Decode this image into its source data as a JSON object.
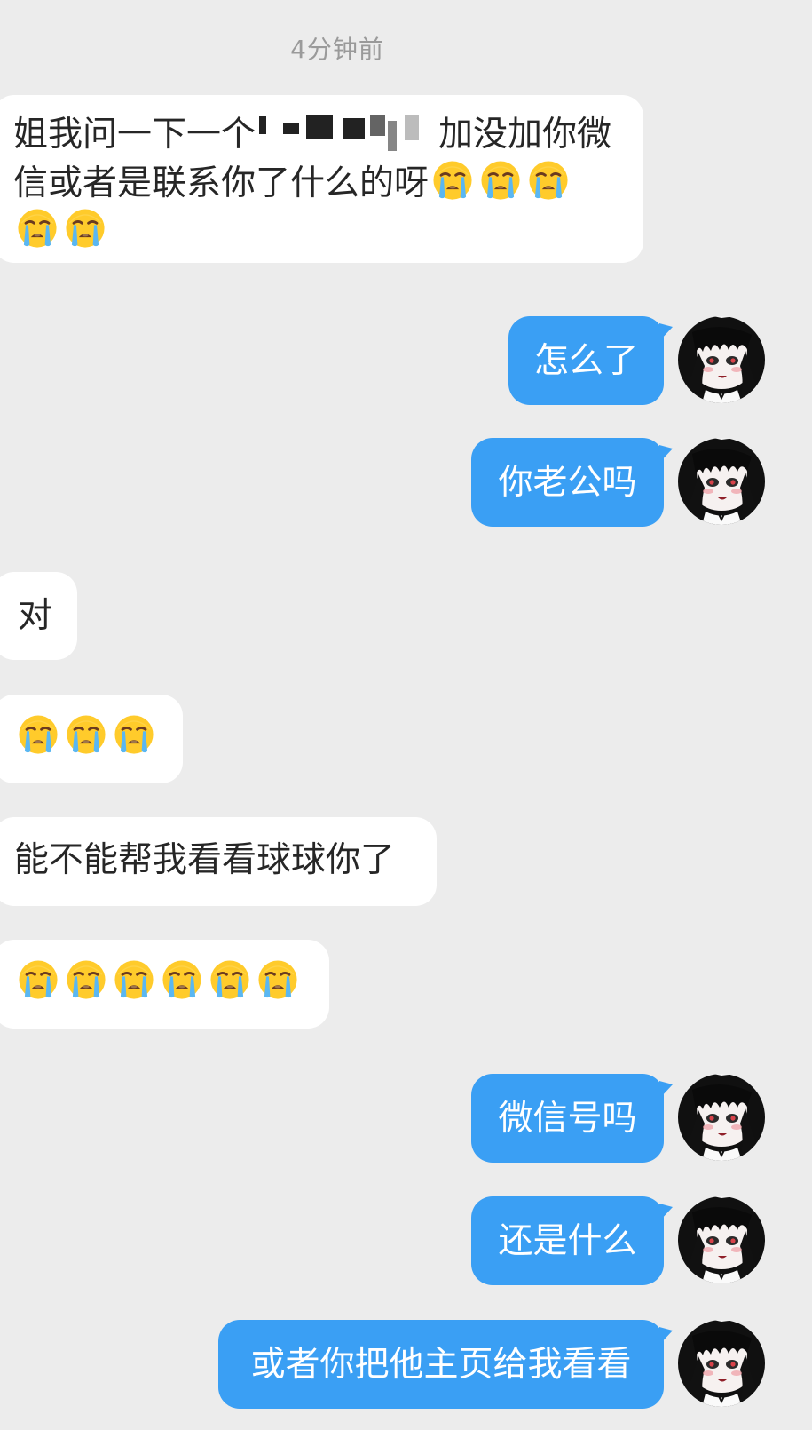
{
  "chat": {
    "timestamp": "4分钟前",
    "messages": [
      {
        "side": "left",
        "line1_prefix": "姐我问一下一个",
        "line1_suffix": "加没加你微",
        "line2": "信或者是联系你了什么的呀",
        "emoji_count": 5
      },
      {
        "side": "right",
        "text": "怎么了"
      },
      {
        "side": "right",
        "text": "你老公吗"
      },
      {
        "side": "left",
        "text": "对"
      },
      {
        "side": "left",
        "text": "",
        "emoji_count": 3
      },
      {
        "side": "left",
        "text": "能不能帮我看看球球你了"
      },
      {
        "side": "left",
        "text": "",
        "emoji_count": 6
      },
      {
        "side": "right",
        "text": "微信号吗"
      },
      {
        "side": "right",
        "text": "还是什么"
      },
      {
        "side": "right",
        "text": "或者你把他主页给我看看"
      }
    ]
  },
  "icons": {
    "emoji": "loudly-crying-face-icon",
    "avatar": "anime-girl-avatar"
  },
  "colors": {
    "background": "#ececec",
    "incoming_bubble": "#ffffff",
    "outgoing_bubble": "#3a9ff4",
    "timestamp": "#9a9a9a"
  }
}
